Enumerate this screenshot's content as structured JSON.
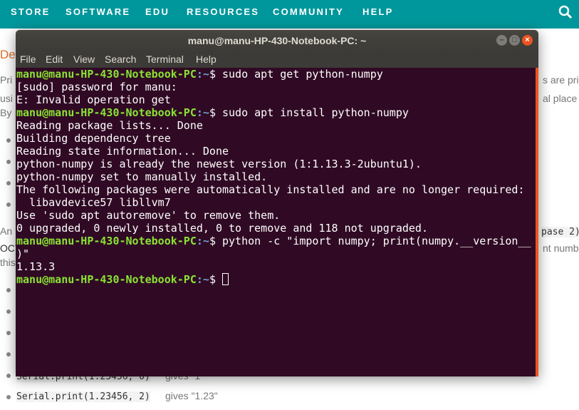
{
  "site_nav": {
    "items": [
      "STORE",
      "SOFTWARE",
      "EDU",
      "RESOURCES",
      "COMMUNITY",
      "HELP"
    ],
    "search_icon": "search-icon",
    "color": "#00979c"
  },
  "background_page": {
    "heading_fragment": "De",
    "left_fragments": [
      "Pri",
      "usi",
      "By",
      "An",
      "OCT",
      "this"
    ],
    "right_fragments": [
      "s are pri",
      "al place",
      "pase 2)",
      "nt numb"
    ],
    "code_partial": "Serial.print(1.23456, 0)",
    "gives_partial": "gives \"1\"",
    "code_last": "Serial.print(1.23456, 2)",
    "gives_last": "gives \"1.23\""
  },
  "terminal": {
    "title": "manu@manu-HP-430-Notebook-PC: ~",
    "menu": [
      "File",
      "Edit",
      "View",
      "Search",
      "Terminal",
      "Help"
    ],
    "prompt_user": "manu@manu-HP-430-Notebook-PC",
    "prompt_path": ":~",
    "prompt_symbol": "$ ",
    "lines": [
      {
        "cmd": "sudo apt get python-numpy"
      },
      {
        "text": "[sudo] password for manu:"
      },
      {
        "text": "E: Invalid operation get"
      },
      {
        "cmd": "sudo apt install python-numpy"
      },
      {
        "text": "Reading package lists... Done"
      },
      {
        "text": "Building dependency tree"
      },
      {
        "text": "Reading state information... Done"
      },
      {
        "text": "python-numpy is already the newest version (1:1.13.3-2ubuntu1)."
      },
      {
        "text": "python-numpy set to manually installed."
      },
      {
        "text": "The following packages were automatically installed and are no longer required:"
      },
      {
        "text": "  libavdevice57 libllvm7"
      },
      {
        "text": "Use 'sudo apt autoremove' to remove them."
      },
      {
        "text": "0 upgraded, 0 newly installed, 0 to remove and 118 not upgraded."
      },
      {
        "cmd": "python -c \"import numpy; print(numpy.__version__"
      },
      {
        "text": ")\""
      },
      {
        "text": "1.13.3"
      },
      {
        "cmd": "",
        "cursor": true
      }
    ],
    "colors": {
      "background": "#300a24",
      "prompt_user": "#8ae234",
      "prompt_path": "#729fcf",
      "scrollbar": "#e95420"
    }
  }
}
